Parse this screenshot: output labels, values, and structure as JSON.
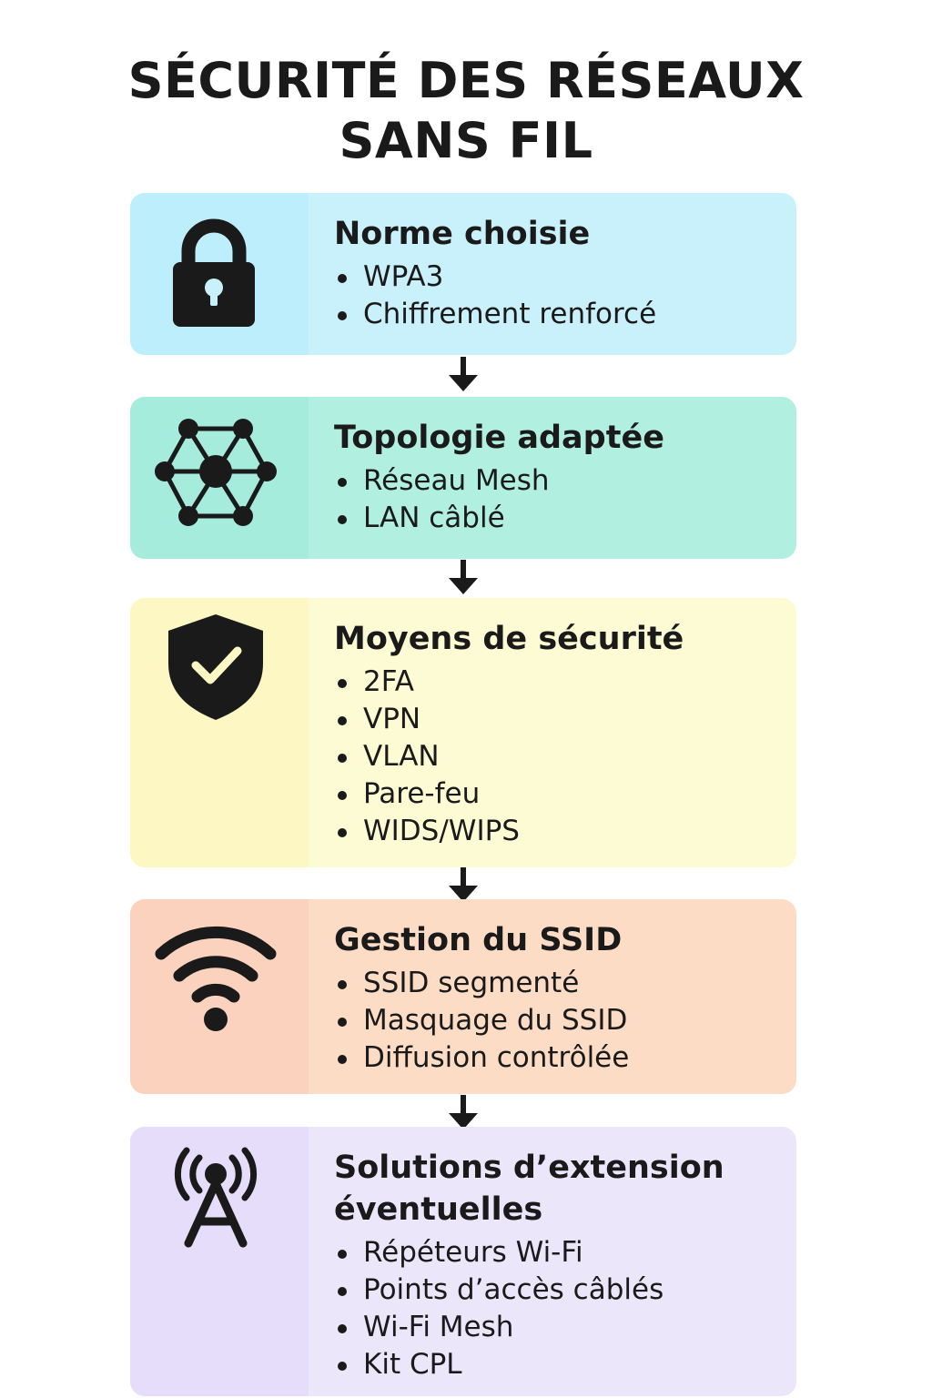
{
  "title": {
    "line1": "SÉCURITÉ DES RÉSEAUX",
    "line2": "SANS FIL"
  },
  "colors": {
    "card1": "#c9f1fb",
    "card2": "#b1f0e1",
    "card3": "#fdfbd3",
    "card4": "#fddcc6",
    "card5": "#ece6fb",
    "ink": "#1a1a1a"
  },
  "steps": [
    {
      "icon": "lock-icon",
      "heading": "Norme choisie",
      "items": [
        "WPA3",
        "Chiffrement renforcé"
      ]
    },
    {
      "icon": "network-icon",
      "heading": "Topologie adaptée",
      "items": [
        "Réseau Mesh",
        "LAN câblé"
      ]
    },
    {
      "icon": "shield-check-icon",
      "heading": "Moyens de sécurité",
      "items": [
        "2FA",
        "VPN",
        "VLAN",
        "Pare-feu",
        "WIDS/WIPS"
      ]
    },
    {
      "icon": "wifi-icon",
      "heading": "Gestion du SSID",
      "items": [
        "SSID segmenté",
        "Masquage du SSID",
        "Diffusion contrôlée"
      ]
    },
    {
      "icon": "antenna-icon",
      "heading_line1": "Solutions d’extension",
      "heading_line2": "éventuelles",
      "items": [
        "Répéteurs Wi-Fi",
        "Points d’accès câblés",
        "Wi-Fi Mesh",
        "Kit CPL"
      ]
    }
  ]
}
